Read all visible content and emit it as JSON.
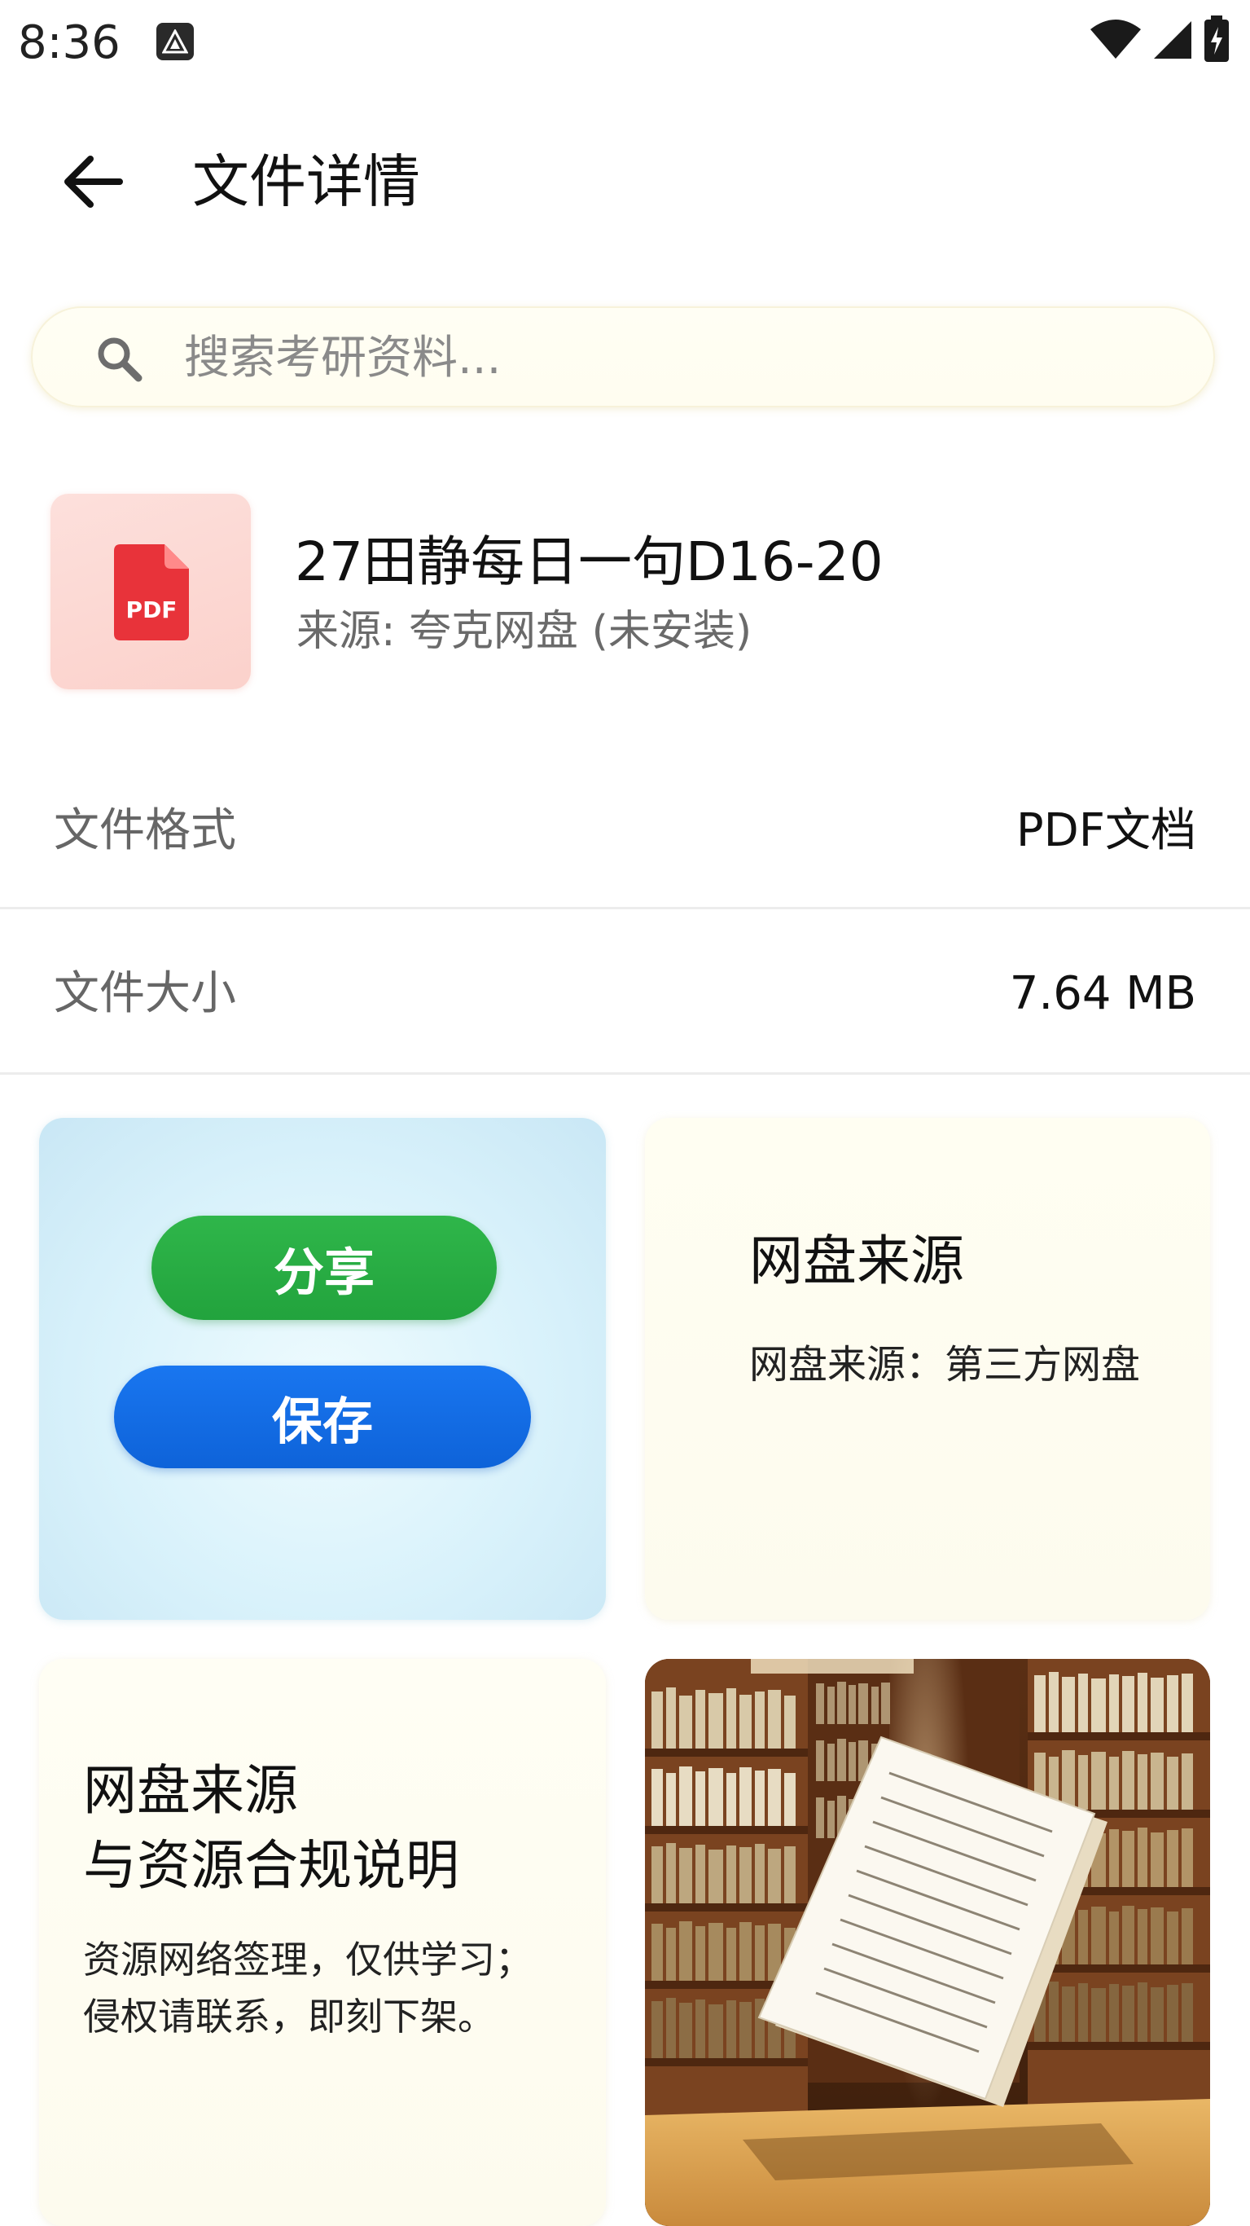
{
  "status_bar": {
    "time": "8:36"
  },
  "header": {
    "title": "文件详情"
  },
  "search": {
    "placeholder": "搜索考研资料..."
  },
  "file": {
    "name": "27田静每日一句D16-20",
    "source": "来源: 夸克网盘 (未安装)",
    "icon_label": "PDF"
  },
  "info": {
    "format_label": "文件格式",
    "format_value": "PDF文档",
    "size_label": "文件大小",
    "size_value": "7.64 MB"
  },
  "actions": {
    "share_label": "分享",
    "save_label": "保存"
  },
  "source_card": {
    "title": "网盘来源",
    "text": "网盘来源：第三方网盘"
  },
  "compliance_card": {
    "title_line1": "网盘来源",
    "title_line2": "与资源合规说明",
    "text_line1": "资源网络签理，仅供学习；",
    "text_line2": "侵权请联系，即刻下架。"
  },
  "colors": {
    "share_button": "#22a33d",
    "save_button": "#0e63d9",
    "pdf_icon": "#e53935"
  },
  "icons": {
    "back": "arrow-left-icon",
    "search": "search-icon",
    "file": "pdf-file-icon"
  }
}
